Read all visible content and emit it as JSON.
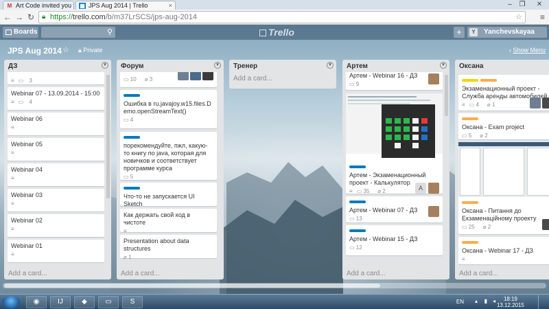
{
  "browser": {
    "tabs": [
      {
        "label": "Art Code invited you to a",
        "favicon": "gmail-icon"
      },
      {
        "label": "JPS Aug 2014 | Trello",
        "favicon": "trello-icon"
      }
    ],
    "address": {
      "scheme": "https://",
      "host": "trello.com",
      "path": "/b/m37LrSCS/jps-aug-2014"
    }
  },
  "header": {
    "boards_label": "Boards",
    "logo": "Trello",
    "plus_label": "+",
    "user_initial": "Y",
    "user_name": "Yanchevskayaa"
  },
  "board": {
    "title": "JPS Aug 2014",
    "visibility": "Private",
    "show_menu": "Show Menu"
  },
  "lists": [
    {
      "name": "ДЗ",
      "add_label": "Add a card...",
      "cards": [
        {
          "title": "",
          "badges": [
            "3"
          ]
        },
        {
          "title": "Webinar 07 - 13.09.2014 - 15:00",
          "badges": [
            "4"
          ]
        },
        {
          "title": "Webinar 06",
          "badges": [
            ""
          ]
        },
        {
          "title": "Webinar 05",
          "badges": [
            ""
          ]
        },
        {
          "title": "Webinar 04",
          "badges": [
            ""
          ]
        },
        {
          "title": "Webinar 03",
          "badges": [
            ""
          ]
        },
        {
          "title": "Webinar 02",
          "badges": [
            ""
          ]
        },
        {
          "title": "Webinar 01",
          "badges": [
            ""
          ]
        }
      ]
    },
    {
      "name": "Форум",
      "add_label": "Add a card...",
      "cards": [
        {
          "title": "",
          "badges": [
            "10",
            "3"
          ]
        },
        {
          "title": "Ошибка в ru.javajoy.w15.files.Demo.openStreamText()",
          "badges": [
            "4"
          ]
        },
        {
          "title": "порекомендуйте, пжл, какую-то книгу по java, которая для новичков и соответствует программе курса",
          "badges": [
            "5"
          ]
        },
        {
          "title": "Что-то не запускается UI Sketch",
          "badges": [
            "4"
          ]
        },
        {
          "title": "Как держать свой код в чистоте",
          "badges": [
            ""
          ]
        },
        {
          "title": "Presentation about data structures",
          "badges": [
            "1"
          ]
        }
      ]
    },
    {
      "name": "Тренер",
      "add_label": "Add a card...",
      "cards": []
    },
    {
      "name": "Артем",
      "add_label": "Add a card...",
      "cards": [
        {
          "title": "Артем - Webinar 16 - ДЗ",
          "badges": [
            "9"
          ]
        },
        {
          "title": "Артем - Экзаменационный проект - Калькулятор",
          "badges": [
            "",
            "35",
            "2"
          ],
          "avatar_initial": "A"
        },
        {
          "title": "Артем - Webinar 07 - ДЗ",
          "badges": [
            "13"
          ]
        },
        {
          "title": "Артем - Webinar 15 - ДЗ",
          "badges": [
            "12"
          ]
        }
      ]
    },
    {
      "name": "Оксана",
      "add_label": "Add a card...",
      "cards": [
        {
          "title": "Экзаменационный проект - Служба аренды автомобилей",
          "badges": [
            "",
            "4",
            "1"
          ]
        },
        {
          "title": "Оксана - Exam project",
          "badges": [
            "5",
            "2"
          ]
        },
        {
          "title": "Оксана - Питання до Екзаменаційному проекту",
          "badges": [
            "25",
            "2"
          ]
        },
        {
          "title": "Оксана - Webinar 17 - ДЗ",
          "badges": [
            ""
          ]
        }
      ]
    }
  ],
  "taskbar": {
    "lang": "EN",
    "time": "18:19",
    "date": "13.12.2015"
  },
  "colors": {
    "label_blue": "#0079bf",
    "label_yellow": "#f2d600",
    "label_orange": "#ffab4a"
  }
}
